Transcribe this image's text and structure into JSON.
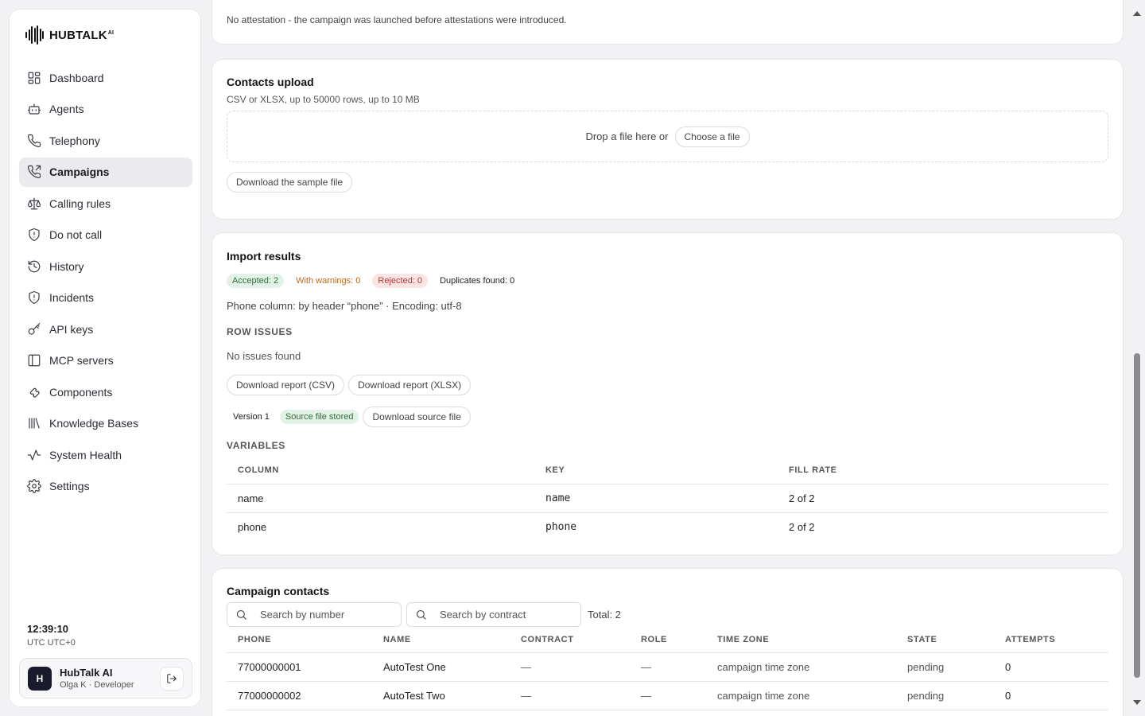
{
  "brand": {
    "name": "HUBTALK",
    "sup": "AI"
  },
  "nav": [
    {
      "label": "Dashboard",
      "icon": "dashboard-icon",
      "active": false
    },
    {
      "label": "Agents",
      "icon": "robot-icon",
      "active": false
    },
    {
      "label": "Telephony",
      "icon": "phone-icon",
      "active": false
    },
    {
      "label": "Campaigns",
      "icon": "phone-outgoing-icon",
      "active": true
    },
    {
      "label": "Calling rules",
      "icon": "scale-icon",
      "active": false
    },
    {
      "label": "Do not call",
      "icon": "shield-icon",
      "active": false
    },
    {
      "label": "History",
      "icon": "history-icon",
      "active": false
    },
    {
      "label": "Incidents",
      "icon": "shield-alert-icon",
      "active": false
    },
    {
      "label": "API keys",
      "icon": "key-icon",
      "active": false
    },
    {
      "label": "MCP servers",
      "icon": "panel-icon",
      "active": false
    },
    {
      "label": "Components",
      "icon": "puzzle-icon",
      "active": false
    },
    {
      "label": "Knowledge Bases",
      "icon": "library-icon",
      "active": false
    },
    {
      "label": "System Health",
      "icon": "activity-icon",
      "active": false
    },
    {
      "label": "Settings",
      "icon": "gear-icon",
      "active": false
    }
  ],
  "clock": {
    "time": "12:39:10",
    "tz": "UTC UTC+0"
  },
  "user": {
    "initial": "H",
    "name": "HubTalk AI",
    "role": "Olga K · Developer"
  },
  "attestation": {
    "note": "No attestation - the campaign was launched before attestations were introduced."
  },
  "upload": {
    "title": "Contacts upload",
    "subtitle": "CSV or XLSX, up to 50000 rows, up to 10 MB",
    "drop_text": "Drop a file here or",
    "choose_label": "Choose a file",
    "sample_label": "Download the sample file"
  },
  "import": {
    "title": "Import results",
    "accepted": "Accepted: 2",
    "warnings": "With warnings: 0",
    "rejected": "Rejected: 0",
    "duplicates": "Duplicates found: 0",
    "info": "Phone column: by header “phone” · Encoding: utf-8",
    "row_issues_label": "ROW ISSUES",
    "no_issues": "No issues found",
    "report_csv": "Download report (CSV)",
    "report_xlsx": "Download report (XLSX)",
    "version": "Version 1",
    "source_badge": "Source file stored",
    "download_source": "Download source file",
    "variables_label": "VARIABLES",
    "variables_columns": [
      "COLUMN",
      "KEY",
      "FILL RATE"
    ],
    "variables_rows": [
      {
        "column": "name",
        "key": "name",
        "fill": "2 of 2"
      },
      {
        "column": "phone",
        "key": "phone",
        "fill": "2 of 2"
      }
    ]
  },
  "contacts": {
    "title": "Campaign contacts",
    "search_number_placeholder": "Search by number",
    "search_contract_placeholder": "Search by contract",
    "total": "Total: 2",
    "columns": [
      "PHONE",
      "NAME",
      "CONTRACT",
      "ROLE",
      "TIME ZONE",
      "STATE",
      "ATTEMPTS"
    ],
    "rows": [
      {
        "phone": "77000000001",
        "name": "AutoTest One",
        "contract": "—",
        "role": "—",
        "tz": "campaign time zone",
        "state": "pending",
        "attempts": "0"
      },
      {
        "phone": "77000000002",
        "name": "AutoTest Two",
        "contract": "—",
        "role": "—",
        "tz": "campaign time zone",
        "state": "pending",
        "attempts": "0"
      }
    ]
  }
}
